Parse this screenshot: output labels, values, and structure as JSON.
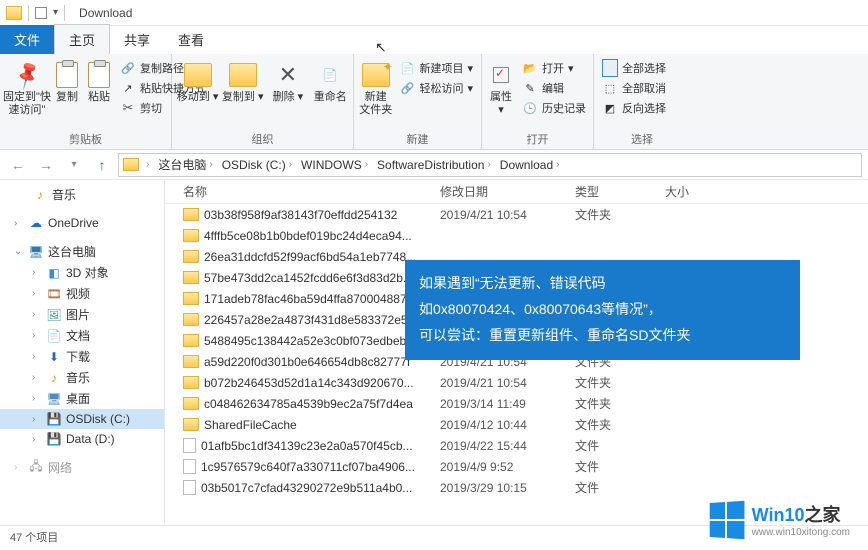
{
  "title": "Download",
  "tabs": {
    "file": "文件",
    "home": "主页",
    "share": "共享",
    "view": "查看"
  },
  "ribbon": {
    "clipboard": {
      "label": "剪贴板",
      "pin": "固定到\"快\n速访问\"",
      "copy": "复制",
      "paste": "粘贴",
      "copypath": "复制路径",
      "shortcut": "粘贴快捷方式",
      "cut": "剪切"
    },
    "organize": {
      "label": "组织",
      "moveto": "移动到",
      "copyto": "复制到",
      "delete": "删除",
      "rename": "重命名"
    },
    "new": {
      "label": "新建",
      "newfolder": "新建\n文件夹",
      "newitem": "新建项目",
      "easyaccess": "轻松访问"
    },
    "open": {
      "label": "打开",
      "properties": "属性",
      "open": "打开",
      "edit": "编辑",
      "history": "历史记录"
    },
    "select": {
      "label": "选择",
      "all": "全部选择",
      "none": "全部取消",
      "invert": "反向选择"
    }
  },
  "breadcrumbs": [
    "这台电脑",
    "OSDisk (C:)",
    "WINDOWS",
    "SoftwareDistribution",
    "Download"
  ],
  "columns": {
    "name": "名称",
    "date": "修改日期",
    "type": "类型",
    "size": "大小"
  },
  "nav": {
    "music": "音乐",
    "onedrive": "OneDrive",
    "pc": "这台电脑",
    "obj3d": "3D 对象",
    "video": "视频",
    "pictures": "图片",
    "documents": "文档",
    "downloads": "下载",
    "music2": "音乐",
    "desktop": "桌面",
    "osdisk": "OSDisk (C:)",
    "data": "Data (D:)",
    "network": "网络"
  },
  "files": [
    {
      "name": "03b38f958f9af38143f70effdd254132",
      "date": "2019/4/21 10:54",
      "type": "文件夹",
      "icon": "folder"
    },
    {
      "name": "4fffb5ce08b1b0bdef019bc24d4eca94...",
      "date": "",
      "type": "",
      "icon": "folder"
    },
    {
      "name": "26ea31ddcfd52f99acf6bd54a1eb7748...",
      "date": "",
      "type": "",
      "icon": "folder"
    },
    {
      "name": "57be473dd2ca1452fcdd6e6f3d83d2b...",
      "date": "",
      "type": "",
      "icon": "folder"
    },
    {
      "name": "171adeb78fac46ba59d4ffa870004887...",
      "date": "",
      "type": "",
      "icon": "folder"
    },
    {
      "name": "226457a28e2a4873f431d8e583372e5...",
      "date": "",
      "type": "",
      "icon": "folder"
    },
    {
      "name": "5488495c138442a52e3c0bf073edbeb...",
      "date": "",
      "type": "",
      "icon": "folder"
    },
    {
      "name": "a59d220f0d301b0e646654db8c82777f",
      "date": "2019/4/21 10:54",
      "type": "文件夹",
      "icon": "folder"
    },
    {
      "name": "b072b246453d52d1a14c343d920670...",
      "date": "2019/4/21 10:54",
      "type": "文件夹",
      "icon": "folder"
    },
    {
      "name": "c048462634785a4539b9ec2a75f7d4ea",
      "date": "2019/3/14 11:49",
      "type": "文件夹",
      "icon": "folder"
    },
    {
      "name": "SharedFileCache",
      "date": "2019/4/12 10:44",
      "type": "文件夹",
      "icon": "folder"
    },
    {
      "name": "01afb5bc1df34139c23e2a0a570f45cb...",
      "date": "2019/4/22 15:44",
      "type": "文件",
      "icon": "file"
    },
    {
      "name": "1c9576579c640f7a330711cf07ba4906...",
      "date": "2019/4/9 9:52",
      "type": "文件",
      "icon": "file"
    },
    {
      "name": "03b5017c7cfad43290272e9b511a4b0...",
      "date": "2019/3/29 10:15",
      "type": "文件",
      "icon": "file"
    }
  ],
  "overlay": {
    "l1": "如果遇到“无法更新、错误代码",
    "l2": "如0x80070424、0x80070643等情况”，",
    "l3": "可以尝试：重置更新组件、重命名SD文件夹"
  },
  "logo": {
    "brand": "Win10",
    "suffix": "之家",
    "url": "www.win10xitong.com"
  },
  "status": {
    "count": "47 个项目"
  }
}
